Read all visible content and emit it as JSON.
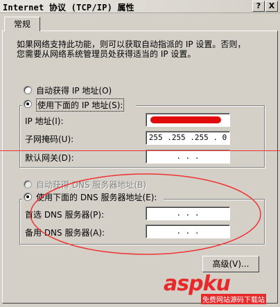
{
  "window": {
    "title": "Internet 协议 (TCP/IP) 属性",
    "help_btn": "?",
    "close_btn": "X"
  },
  "tab": {
    "label": "常规"
  },
  "description": "如果网络支持此功能，则可以获取自动指派的 IP 设置。否则，您需要从网络系统管理员处获得适当的 IP 设置。",
  "ip": {
    "auto_label": "自动获得 IP 地址(O)",
    "manual_label": "使用下面的 IP 地址(S):",
    "ip_label": "IP 地址(I):",
    "mask_label": "子网掩码(U):",
    "gateway_label": "默认网关(D):",
    "ip_value": "",
    "mask_value": "255 .255 .255 . 0",
    "gateway_value": " .  .  . "
  },
  "dns": {
    "auto_label": "自动获得 DNS 服务器地址(B)",
    "manual_label": "使用下面的 DNS 服务器地址(E):",
    "preferred_label": "首选 DNS 服务器(P):",
    "alternate_label": "备用 DNS 服务器(A):",
    "preferred_value": " .  .  . ",
    "alternate_value": " .  .  . "
  },
  "advanced_btn": "高级(V)...",
  "watermark": {
    "brand": "aspku",
    "sub": "免费网站源码下载站"
  },
  "colors": {
    "annotation_red": "#e33",
    "watermark_red": "#e7292a"
  }
}
